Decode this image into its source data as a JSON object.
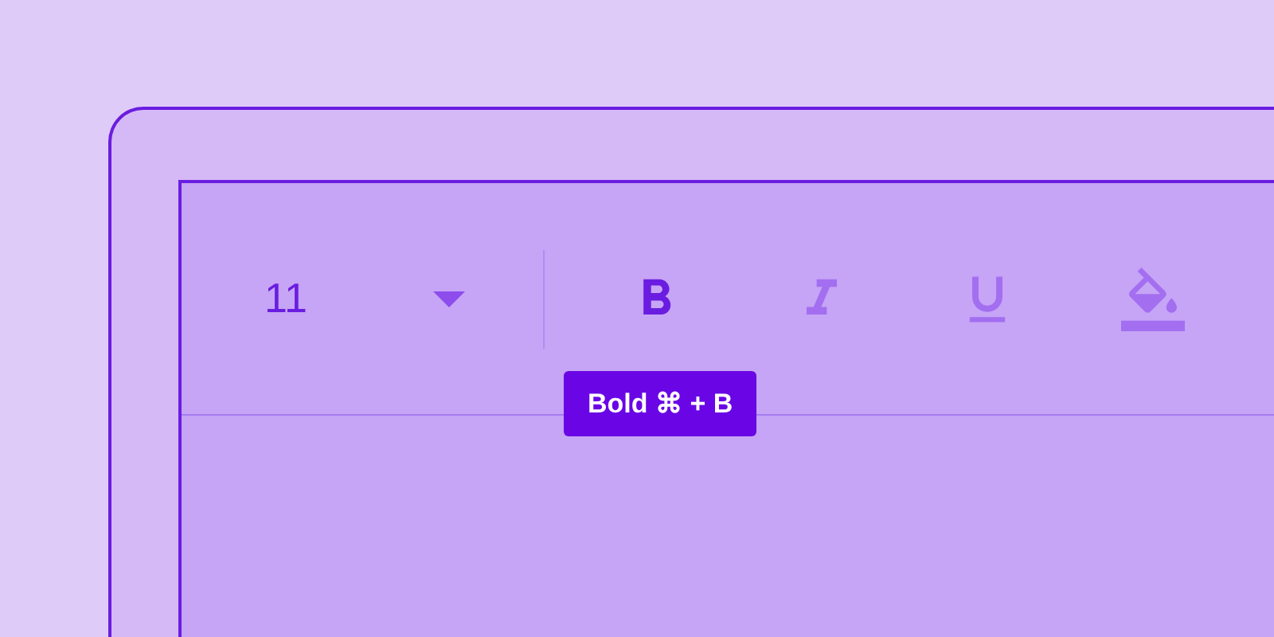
{
  "font_size": {
    "value": "11"
  },
  "tools": [
    {
      "kind": "bold",
      "selected": true
    },
    {
      "kind": "italic",
      "selected": false
    },
    {
      "kind": "underline",
      "selected": false
    },
    {
      "kind": "fill",
      "selected": false
    }
  ],
  "tooltip": {
    "text": "Bold ⌘ + B"
  }
}
